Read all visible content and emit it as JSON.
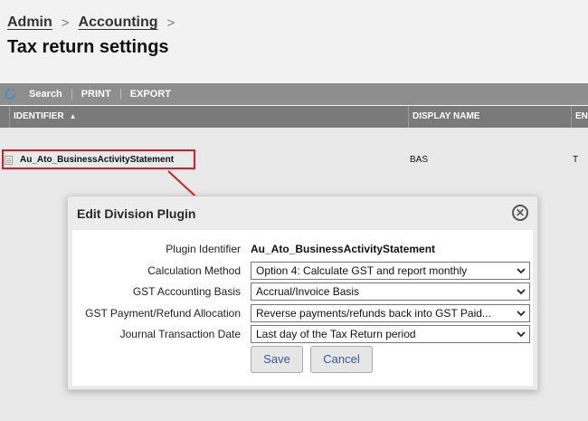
{
  "breadcrumb": {
    "items": [
      "Admin",
      "Accounting"
    ],
    "separator": ">"
  },
  "page": {
    "title": "Tax return settings"
  },
  "toolbar": {
    "search": "Search",
    "print": "PRINT",
    "export": "EXPORT"
  },
  "grid": {
    "columns": [
      "IDENTIFIER",
      "DISPLAY NAME",
      "EN"
    ],
    "sort_indicator": "▲",
    "rows": [
      {
        "identifier": "Au_Ato_BusinessActivityStatement",
        "display_name": "BAS",
        "en": "T"
      }
    ]
  },
  "dialog": {
    "title": "Edit Division Plugin",
    "close": "✕",
    "fields": [
      {
        "label": "Plugin Identifier",
        "value": "Au_Ato_BusinessActivityStatement"
      },
      {
        "label": "Calculation Method",
        "value": "Option 4: Calculate GST and report monthly"
      },
      {
        "label": "GST Accounting Basis",
        "value": "Accrual/Invoice Basis"
      },
      {
        "label": "GST Payment/Refund Allocation",
        "value": "Reverse payments/refunds back into GST Paid..."
      },
      {
        "label": "Journal Transaction Date",
        "value": "Last day of the Tax Return period"
      }
    ],
    "save": "Save",
    "cancel": "Cancel"
  },
  "colors": {
    "highlight": "#d0202a",
    "toolbar": "#8e8e8e",
    "header": "#7a7a7a",
    "button_text": "#3a5a8c"
  },
  "icons": [
    "refresh-icon",
    "document-icon",
    "close-icon",
    "chevron-down-icon",
    "sort-up-icon"
  ]
}
